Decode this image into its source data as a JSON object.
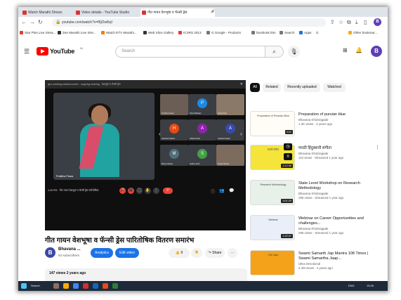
{
  "browser": {
    "tabs": [
      {
        "label": "Watch Marathi Shows"
      },
      {
        "label": "Video details - YouTube Studio"
      },
      {
        "label": "गीत गायन वेशभूषा व फॅन्सी ड्रेस"
      }
    ],
    "new_tab": "+",
    "url": "youtube.com/watch?v=f5jOw8vjI",
    "profile_initial": "B",
    "bookmarks": [
      {
        "label": "Star Plus Live Strea...",
        "color": "#e53935"
      },
      {
        "label": "Zee Marathi Live Stre...",
        "color": "#333333"
      },
      {
        "label": "Watch ETV Marathi...",
        "color": "#f57c00"
      },
      {
        "label": "Web Slice Gallery",
        "color": "#333333"
      },
      {
        "label": "ICSRS 2013",
        "color": "#e53935"
      },
      {
        "label": "G Google - Products",
        "color": "#777777"
      },
      {
        "label": "facebook.htm",
        "color": "#777777"
      },
      {
        "label": "Search",
        "color": "#777777"
      },
      {
        "label": "Apps",
        "color": "#1a73e8"
      },
      {
        "label": "G",
        "color": "#777777"
      },
      {
        "label": "Other bookmar...",
        "color": "#f9ab00"
      }
    ]
  },
  "youtube": {
    "logo_text": "YouTube",
    "country": "IN",
    "search_placeholder": "Search",
    "avatar_initial": "B"
  },
  "player": {
    "meet_bar_text": "geo meeting-shared-screen · ongoing meeting · बेशभूषा व फॅन्सी ड्रेस",
    "main_speaker": "Pratibha Pawar",
    "participants": [
      {
        "name": "Pratibha Pawar",
        "initial": "",
        "color": "#6b5e55",
        "photo": true
      },
      {
        "name": "Priya Mahajan",
        "initial": "P",
        "color": "#1e88e5",
        "photo": false
      },
      {
        "name": "Sarita Patil",
        "initial": "",
        "color": "#8a7868",
        "photo": true
      },
      {
        "name": "Harshal Kulkarni",
        "initial": "H",
        "color": "#e64a19",
        "photo": false
      },
      {
        "name": "Abhijit Pawar",
        "initial": "A",
        "color": "#8e24aa",
        "photo": false
      },
      {
        "name": "Ashwini Kokate",
        "initial": "A",
        "color": "#3949ab",
        "photo": false
      },
      {
        "name": "Manoj Jadhav",
        "initial": "M",
        "color": "#546e7a",
        "photo": false
      },
      {
        "name": "Sudha Joshi",
        "initial": "S",
        "color": "#43a047",
        "photo": false
      },
      {
        "name": "Rupali Shinde",
        "initial": "",
        "color": "#7d6b5e",
        "photo": true
      }
    ],
    "control_time": "4:49 PM · गीत गायन वेशभूषा व फॅन्सी ड्रेस पारितोषिक",
    "control_buttons": [
      "🎤",
      "🎥",
      "⛶",
      "✋",
      "⋮",
      "✆"
    ]
  },
  "video": {
    "title": "गीत गायन वेशभूषा व फॅन्सी ड्रेस पारितोषिक वितरण समारंभ",
    "channel_initial": "B",
    "channel_name": "Bhavana ...",
    "subscribers": "64 subscribers",
    "analytics_label": "Analytics",
    "edit_label": "Edit video",
    "like_count": "9",
    "share_label": "Share",
    "description_meta": "147 views  2 years ago"
  },
  "sidebar": {
    "chips": [
      "All",
      "Related",
      "Recently uploaded",
      "Watched"
    ],
    "videos": [
      {
        "title": "Preparation of pursian blue",
        "channel": "Bhavana Khobragade",
        "meta": "1.3K views · 2 years ago",
        "duration": "4:21",
        "thumb_bg": "#fffdf5",
        "thumb_text": "Preparation of Prussian Blue"
      },
      {
        "title": "मराठी हिंदुस्थानी संगीता",
        "channel": "Bhavana Khobragade",
        "meta": "110 views · Streamed 1 year ago",
        "duration": "1:12:30",
        "thumb_bg": "#f5e43a",
        "thumb_text": "मराठी संगीत"
      },
      {
        "title": "State Level Workshop on Research Methodology",
        "channel": "Bhavana Khobragade",
        "meta": "296 views · Streamed 1 year ago",
        "duration": "3:01:29",
        "thumb_bg": "#e8f1e9",
        "thumb_text": "Research Methodology"
      },
      {
        "title": "Webinar on Career Opportunities and challenges...",
        "channel": "Bhavana Khobragade",
        "meta": "296 views · Streamed 1 year ago",
        "duration": "1:22:47",
        "thumb_bg": "#e9eef8",
        "thumb_text": "Webinar"
      },
      {
        "title": "Swami Samarth Jap Mantra 108 Times | Swami Samartha Jaap...",
        "channel": "Ultra Devotional",
        "meta": "2.4M views · 4 years ago",
        "duration": "",
        "thumb_bg": "#f4a21a",
        "thumb_text": "108 Jaap"
      }
    ]
  },
  "taskbar": {
    "search_label": "Search",
    "clock": "15:26",
    "tray": "ENG"
  },
  "colors": {
    "yt_red": "#ff0000",
    "accent_blue": "#1a73e8",
    "player_bg": "#0f0f0f"
  }
}
